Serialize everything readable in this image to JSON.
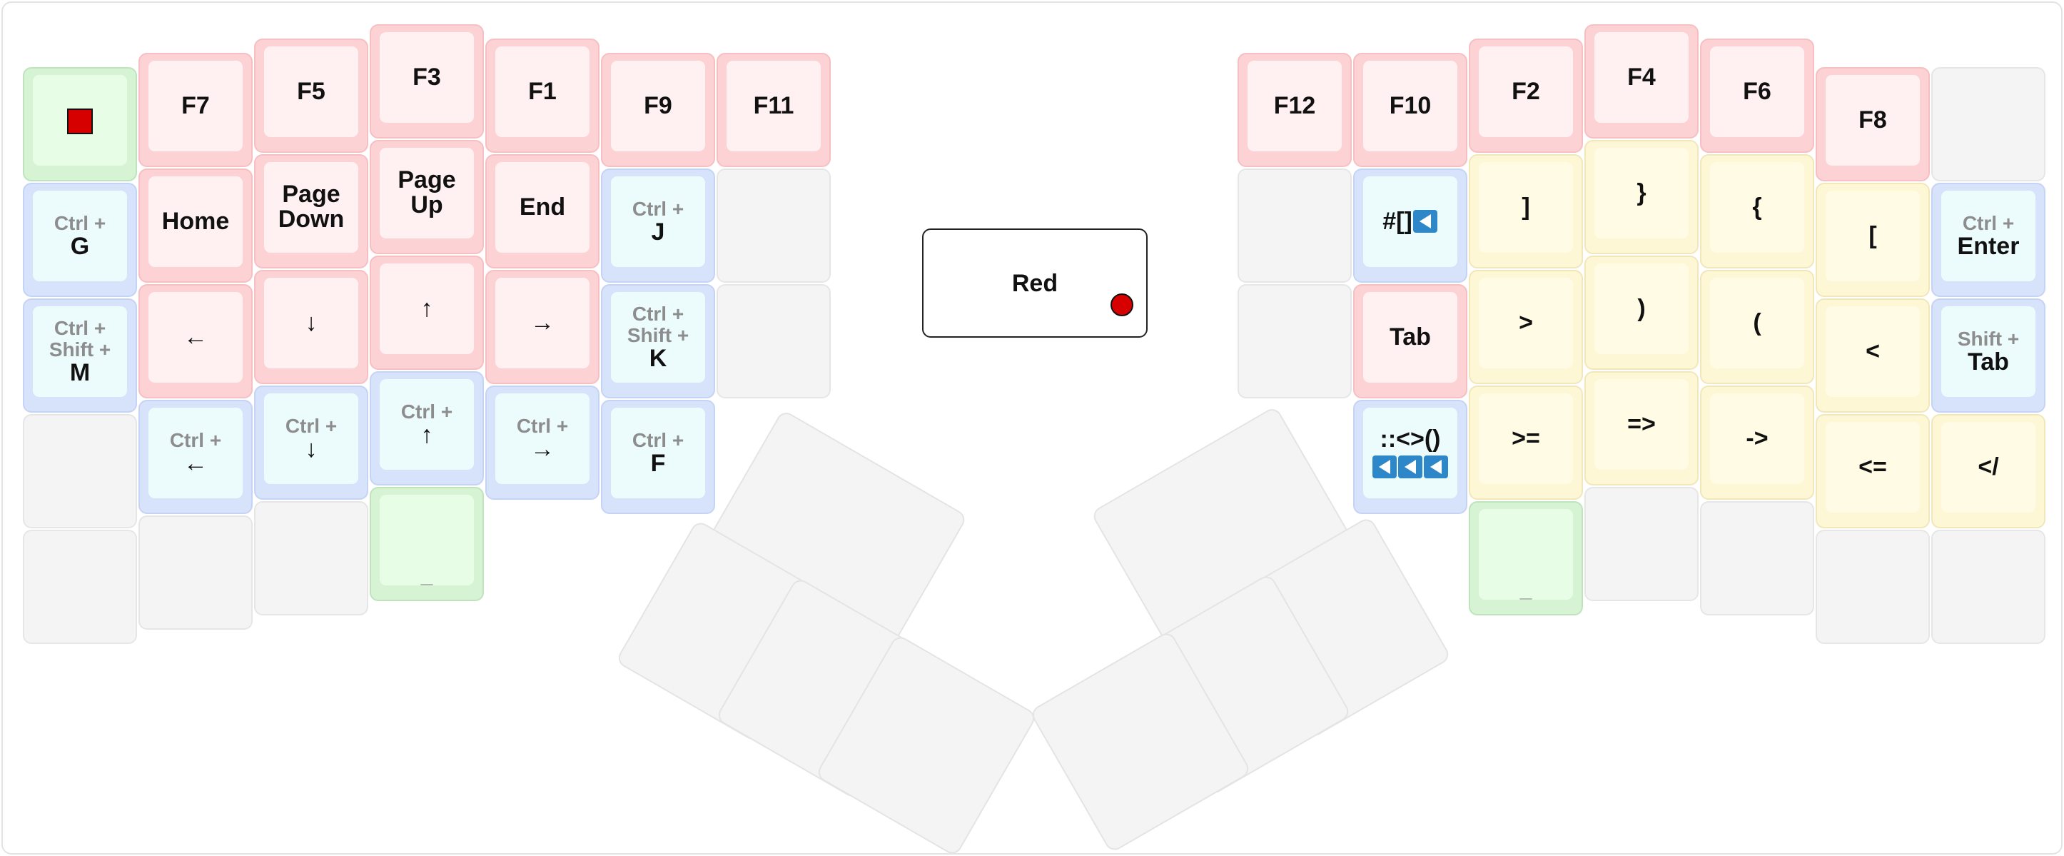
{
  "layer": {
    "name": "Red",
    "color": "#d60000"
  },
  "colors": {
    "pink": "#fdd2d4",
    "blue": "#d7e2fb",
    "yellow": "#fdf7d6",
    "green": "#d6f3d4",
    "gray": "#f4f4f4"
  },
  "left_hand": {
    "col0": [
      {
        "color": "green",
        "icon": "red-square-icon"
      },
      {
        "color": "blue",
        "mod": "Ctrl +",
        "label": "G"
      },
      {
        "color": "blue",
        "mod": "Ctrl +\nShift +",
        "label": "M"
      },
      {
        "color": "gray"
      },
      {
        "color": "gray"
      }
    ],
    "col1": [
      {
        "color": "pink",
        "label": "F7"
      },
      {
        "color": "pink",
        "label": "Home"
      },
      {
        "color": "pink",
        "label": "←"
      },
      {
        "color": "blue",
        "mod": "Ctrl +",
        "label": "←"
      },
      {
        "color": "gray"
      }
    ],
    "col2": [
      {
        "color": "pink",
        "label": "F5"
      },
      {
        "color": "pink",
        "label": "Page\nDown"
      },
      {
        "color": "pink",
        "label": "↓"
      },
      {
        "color": "blue",
        "mod": "Ctrl +",
        "label": "↓"
      },
      {
        "color": "gray"
      }
    ],
    "col3": [
      {
        "color": "pink",
        "label": "F3"
      },
      {
        "color": "pink",
        "label": "Page\nUp"
      },
      {
        "color": "pink",
        "label": "↑"
      },
      {
        "color": "blue",
        "mod": "Ctrl +",
        "label": "↑"
      },
      {
        "color": "green",
        "label": "_"
      }
    ],
    "col4": [
      {
        "color": "pink",
        "label": "F1"
      },
      {
        "color": "pink",
        "label": "End"
      },
      {
        "color": "pink",
        "label": "→"
      },
      {
        "color": "blue",
        "mod": "Ctrl +",
        "label": "→"
      }
    ],
    "col5": [
      {
        "color": "pink",
        "label": "F9"
      },
      {
        "color": "blue",
        "mod": "Ctrl +",
        "label": "J"
      },
      {
        "color": "blue",
        "mod": "Ctrl +\nShift +",
        "label": "K"
      },
      {
        "color": "blue",
        "mod": "Ctrl +",
        "label": "F"
      }
    ],
    "col6": [
      {
        "color": "pink",
        "label": "F11"
      },
      {
        "color": "gray"
      },
      {
        "color": "gray"
      }
    ]
  },
  "right_hand": {
    "col0": [
      {
        "color": "pink",
        "label": "F12"
      },
      {
        "color": "gray"
      },
      {
        "color": "gray"
      }
    ],
    "col1": [
      {
        "color": "pink",
        "label": "F10"
      },
      {
        "color": "blue",
        "label": "#[]",
        "suffix_icons": 1
      },
      {
        "color": "pink",
        "label": "Tab"
      },
      {
        "color": "blue",
        "label": "::<>()",
        "below_icons": 3
      }
    ],
    "col2": [
      {
        "color": "pink",
        "label": "F2"
      },
      {
        "color": "yellow",
        "label": "]"
      },
      {
        "color": "yellow",
        "label": ">"
      },
      {
        "color": "yellow",
        "label": ">="
      },
      {
        "color": "green",
        "label": "_"
      }
    ],
    "col3": [
      {
        "color": "pink",
        "label": "F4"
      },
      {
        "color": "yellow",
        "label": "}"
      },
      {
        "color": "yellow",
        "label": ")"
      },
      {
        "color": "yellow",
        "label": "=>"
      },
      {
        "color": "gray"
      }
    ],
    "col4": [
      {
        "color": "pink",
        "label": "F6"
      },
      {
        "color": "yellow",
        "label": "{"
      },
      {
        "color": "yellow",
        "label": "("
      },
      {
        "color": "yellow",
        "label": "->"
      },
      {
        "color": "gray"
      }
    ],
    "col5": [
      {
        "color": "pink",
        "label": "F8"
      },
      {
        "color": "yellow",
        "label": "["
      },
      {
        "color": "yellow",
        "label": "<"
      },
      {
        "color": "yellow",
        "label": "<="
      },
      {
        "color": "gray"
      }
    ],
    "col6": [
      {
        "color": "gray"
      },
      {
        "color": "blue",
        "mod": "Ctrl +",
        "label": "Enter"
      },
      {
        "color": "blue",
        "mod": "Shift +",
        "label": "Tab"
      },
      {
        "color": "yellow",
        "label": "</"
      },
      {
        "color": "gray"
      }
    ]
  }
}
